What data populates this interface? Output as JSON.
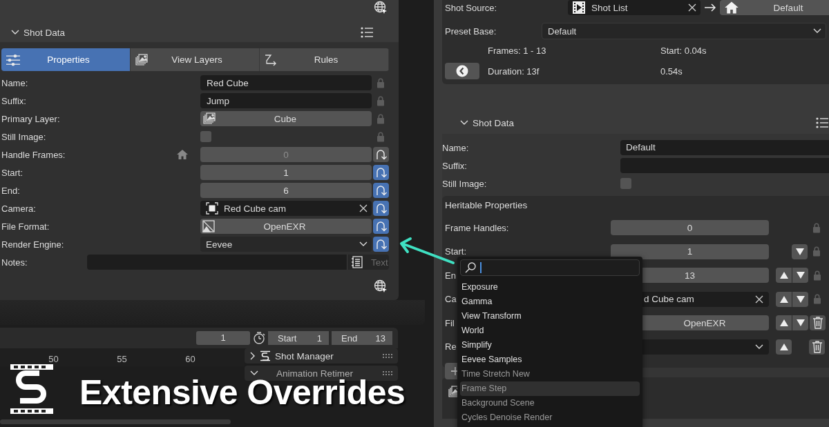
{
  "left_panel": {
    "section_title": "Shot Data",
    "tabs": [
      {
        "label": "Properties",
        "selected": true
      },
      {
        "label": "View Layers",
        "selected": false
      },
      {
        "label": "Rules",
        "selected": false
      }
    ],
    "rows": [
      {
        "label": "Name:",
        "kind": "text",
        "value": "Red Cube",
        "trailing": {
          "kind": "lock"
        }
      },
      {
        "label": "Suffix:",
        "kind": "text",
        "value": "Jump",
        "trailing": {
          "kind": "lock"
        }
      },
      {
        "label": "Primary Layer:",
        "kind": "layer",
        "value": "Cube",
        "trailing": {
          "kind": "lock"
        }
      },
      {
        "label": "Still Image:",
        "kind": "checkbox",
        "checked": false,
        "trailing": {
          "kind": "lock"
        }
      },
      {
        "label": "Handle Frames:",
        "kind": "number",
        "value": "0",
        "inherited": true,
        "disabled": true,
        "trailing": {
          "kind": "revert",
          "overridden": false
        }
      },
      {
        "label": "Start:",
        "kind": "number",
        "value": "1",
        "inherited": false,
        "disabled": false,
        "trailing": {
          "kind": "revert",
          "overridden": true
        }
      },
      {
        "label": "End:",
        "kind": "number",
        "value": "6",
        "inherited": false,
        "disabled": false,
        "trailing": {
          "kind": "revert",
          "overridden": true
        }
      },
      {
        "label": "Camera:",
        "kind": "camera",
        "value": "Red Cube cam",
        "trailing": {
          "kind": "revert",
          "overridden": true
        }
      },
      {
        "label": "File Format:",
        "kind": "format",
        "value": "OpenEXR",
        "trailing": {
          "kind": "revert",
          "overridden": true
        }
      },
      {
        "label": "Render Engine:",
        "kind": "dropdown",
        "value": "Eevee",
        "trailing": {
          "kind": "revert",
          "overridden": true
        }
      },
      {
        "label": "Notes:",
        "kind": "notes",
        "button": "Text"
      }
    ]
  },
  "right_panel": {
    "shot_source": {
      "label": "Shot Source:",
      "value": "Shot List",
      "target": "Default"
    },
    "preset_base": {
      "label": "Preset Base:",
      "value": "Default"
    },
    "info": [
      "Frames: 1 - 13",
      "Start: 0.04s",
      "Duration: 13f",
      "0.54s"
    ],
    "section_title": "Shot Data",
    "rows": [
      {
        "label": "Name:",
        "kind": "text",
        "value": "Default"
      },
      {
        "label": "Suffix:",
        "kind": "text"
      },
      {
        "label": "Still Image:",
        "kind": "checkbox",
        "checked": false
      }
    ],
    "heritable": {
      "title": "Heritable Properties",
      "rows": [
        {
          "label": "Frame Handles:",
          "kind": "number",
          "value": "0",
          "up": false,
          "down": false,
          "trailing": {
            "kind": "lock"
          }
        },
        {
          "label": "Start:",
          "kind": "number",
          "value": "1",
          "up": false,
          "down": true,
          "trailing": {
            "kind": "lock"
          }
        },
        {
          "label": "En",
          "kind": "number",
          "value": "13",
          "up": true,
          "down": true,
          "trailing": {
            "kind": "lock"
          }
        },
        {
          "label": "Ca",
          "kind": "camera",
          "value": "d Cube cam",
          "up": true,
          "down": true,
          "trailing": {
            "kind": "lock"
          }
        },
        {
          "label": "Fil",
          "kind": "format",
          "value": "OpenEXR",
          "up": true,
          "down": true,
          "trailing": {
            "kind": "delete"
          }
        },
        {
          "label": "Re",
          "kind": "dropdown",
          "up": true,
          "down": false,
          "trailing": {
            "kind": "delete"
          }
        }
      ]
    }
  },
  "popup": {
    "items": [
      {
        "label": "Exposure",
        "selected": false,
        "disabled": false
      },
      {
        "label": "Gamma",
        "selected": false,
        "disabled": false
      },
      {
        "label": "View Transform",
        "selected": false,
        "disabled": false
      },
      {
        "label": "World",
        "selected": false,
        "disabled": false
      },
      {
        "label": "Simplify",
        "selected": false,
        "disabled": false
      },
      {
        "label": "Eevee Samples",
        "selected": false,
        "disabled": false
      },
      {
        "label": "Time Stretch New",
        "selected": false,
        "disabled": true
      },
      {
        "label": "Frame Step",
        "selected": true,
        "disabled": true
      },
      {
        "label": "Background Scene",
        "selected": false,
        "disabled": true
      },
      {
        "label": "Cycles Denoise Render",
        "selected": false,
        "disabled": true
      }
    ]
  },
  "timeline": {
    "current_frame": "1",
    "start_label": "Start",
    "start": "1",
    "end_label": "End",
    "end": "13",
    "ruler": [
      "50",
      "55",
      "60"
    ],
    "panels": [
      {
        "title": "Shot Manager",
        "expanded": false
      },
      {
        "title": "Animation Retimer",
        "expanded": true
      }
    ]
  },
  "overlay_title": "Extensive Overrides"
}
